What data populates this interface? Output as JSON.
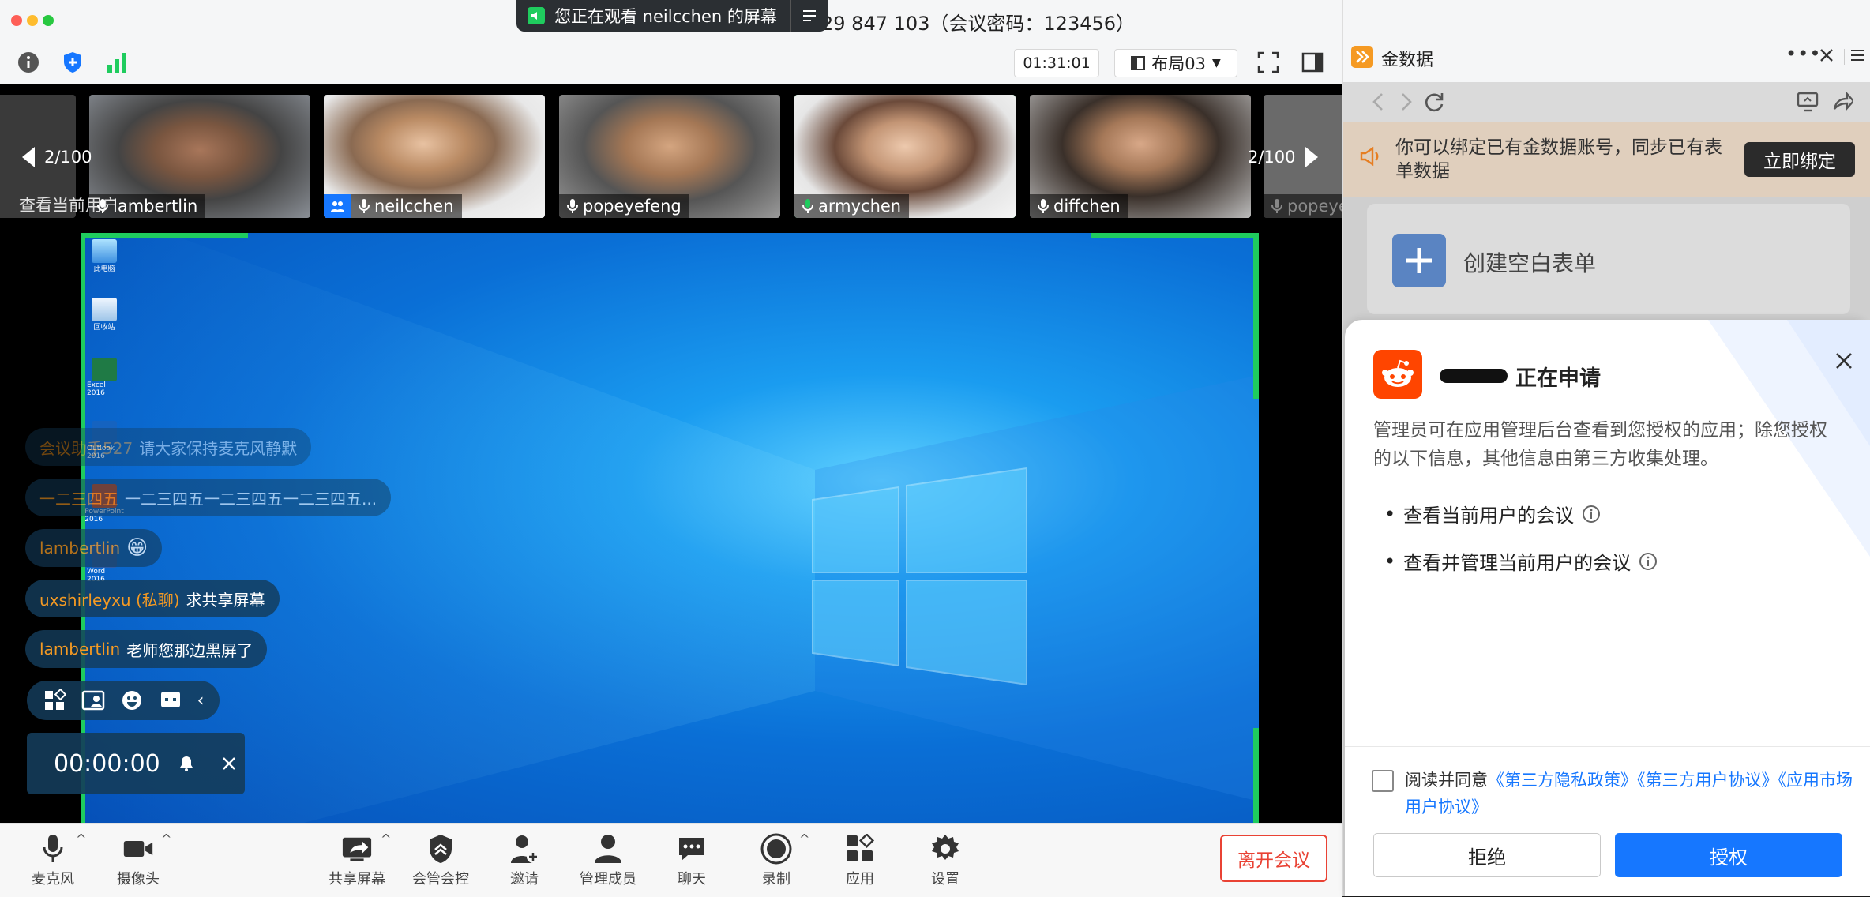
{
  "title_bar": {
    "meeting_info": "29 847 103（会议密码：123456）",
    "share_banner": "您正在观看 neilcchen 的屏幕"
  },
  "toolbar": {
    "timer": "01:31:01",
    "layout_label": "布局03"
  },
  "participants": {
    "page_left": "2/100",
    "page_right": "2/100",
    "overlay_text": "查看当前用户",
    "items": [
      {
        "name": "lambertlin",
        "active": false
      },
      {
        "name": "neilcchen",
        "active": false
      },
      {
        "name": "popeyefeng",
        "active": false
      },
      {
        "name": "armychen",
        "active": true
      },
      {
        "name": "diffchen",
        "active": false
      },
      {
        "name": "popeye",
        "active": false
      }
    ]
  },
  "desktop_icons": [
    "此电脑",
    "回收站",
    "Excel 2016",
    "Outlook 2016",
    "PowerPoint 2016",
    "Word 2016"
  ],
  "chat": [
    {
      "who": "会议助手527",
      "text": "请大家保持麦克风静默"
    },
    {
      "who": "一二三四五",
      "text": "一二三四五一二三四五一二三四五..."
    },
    {
      "who": "lambertlin",
      "text": "😁"
    },
    {
      "who": "uxshirleyxu (私聊)",
      "text": "求共享屏幕"
    },
    {
      "who": "lambertlin",
      "text": "老师您那边黑屏了"
    }
  ],
  "recorder": {
    "time": "00:00:00"
  },
  "bottom_bar": {
    "mic": "麦克风",
    "camera": "摄像头",
    "share": "共享屏幕",
    "control": "会管会控",
    "invite": "邀请",
    "members": "管理成员",
    "chat": "聊天",
    "record": "录制",
    "apps": "应用",
    "settings": "设置",
    "leave": "离开会议"
  },
  "panel": {
    "title": "金数据",
    "notice": "你可以绑定已有金数据账号，同步已有表单数据",
    "bind_button": "立即绑定",
    "create_form": "创建空白表单",
    "dialog": {
      "applying": "正在申请",
      "description": "管理员可在应用管理后台查看到您授权的应用；除您授权的以下信息，其他信息由第三方收集处理。",
      "permissions": [
        "查看当前用户的会议",
        "查看并管理当前用户的会议"
      ],
      "agree_prefix": "阅读并同意",
      "links": [
        "《第三方隐私政策》",
        "《第三方用户协议》",
        "《应用市场用户协议》"
      ],
      "reject": "拒绝",
      "authorize": "授权"
    }
  },
  "colors": {
    "accent_green": "#1fcc5e",
    "primary_blue": "#1677ff",
    "leave_red": "#e94234",
    "chat_name_orange": "#f59a23"
  }
}
